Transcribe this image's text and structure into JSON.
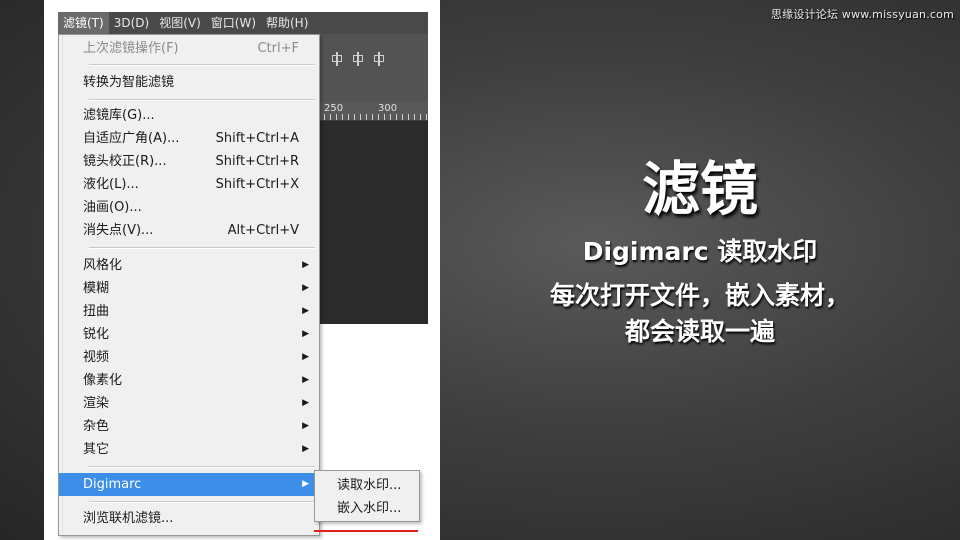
{
  "watermark": "思缘设计论坛 www.missyuan.com",
  "menubar": {
    "items": [
      {
        "label": "滤镜(T)"
      },
      {
        "label": "3D(D)"
      },
      {
        "label": "视图(V)"
      },
      {
        "label": "窗口(W)"
      },
      {
        "label": "帮助(H)"
      }
    ]
  },
  "ruler": {
    "labels": [
      "250",
      "300"
    ]
  },
  "filter_menu": {
    "items": [
      {
        "label": "上次滤镜操作(F)",
        "shortcut": "Ctrl+F",
        "state": "disabled"
      },
      {
        "label": "转换为智能滤镜"
      },
      {
        "label": "滤镜库(G)..."
      },
      {
        "label": "自适应广角(A)...",
        "shortcut": "Shift+Ctrl+A"
      },
      {
        "label": "镜头校正(R)...",
        "shortcut": "Shift+Ctrl+R"
      },
      {
        "label": "液化(L)...",
        "shortcut": "Shift+Ctrl+X"
      },
      {
        "label": "油画(O)..."
      },
      {
        "label": "消失点(V)...",
        "shortcut": "Alt+Ctrl+V"
      },
      {
        "label": "风格化",
        "submenu": true
      },
      {
        "label": "模糊",
        "submenu": true
      },
      {
        "label": "扭曲",
        "submenu": true
      },
      {
        "label": "锐化",
        "submenu": true
      },
      {
        "label": "视频",
        "submenu": true
      },
      {
        "label": "像素化",
        "submenu": true
      },
      {
        "label": "渲染",
        "submenu": true
      },
      {
        "label": "杂色",
        "submenu": true
      },
      {
        "label": "其它",
        "submenu": true
      },
      {
        "label": "Digimarc",
        "submenu": true,
        "state": "highlighted"
      },
      {
        "label": "浏览联机滤镜..."
      }
    ]
  },
  "digimarc_submenu": {
    "items": [
      {
        "label": "读取水印..."
      },
      {
        "label": "嵌入水印..."
      }
    ]
  },
  "slide": {
    "title": "滤镜",
    "subtitle": "Digimarc 读取水印",
    "description_line1": "每次打开文件，嵌入素材，",
    "description_line2": "都会读取一遍"
  },
  "colors": {
    "menu_highlight": "#3c8ee8",
    "underline_accent": "#e02020",
    "menu_background": "#f0f0f0",
    "photoshop_panel": "#535353"
  }
}
